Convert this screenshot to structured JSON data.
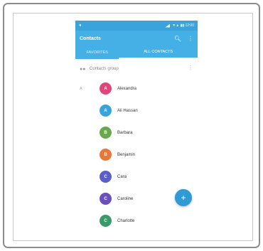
{
  "status": {
    "left": "●",
    "right": "▼▲ ▮▮ 12:00"
  },
  "appbar": {
    "title": "Contacts",
    "search_icon": "search-icon",
    "more_icon": "more-vert-icon"
  },
  "tabs": [
    {
      "label": "Favorites"
    },
    {
      "label": "All contacts"
    }
  ],
  "group": {
    "icon": "group-icon",
    "label": "Contacts group"
  },
  "contacts": [
    {
      "letter": "A",
      "initial": "A",
      "name": "Alexandra",
      "color": "#e0457a"
    },
    {
      "letter": "",
      "initial": "A",
      "name": "Ali Hassan",
      "color": "#3aa3db"
    },
    {
      "letter": "",
      "initial": "B",
      "name": "Barbara",
      "color": "#6aa84f"
    },
    {
      "letter": "",
      "initial": "B",
      "name": "Benjamin",
      "color": "#e8783a"
    },
    {
      "letter": "",
      "initial": "C",
      "name": "Cara",
      "color": "#5c5fc7"
    },
    {
      "letter": "",
      "initial": "C",
      "name": "Caroline",
      "color": "#6a4fbf"
    },
    {
      "letter": "",
      "initial": "C",
      "name": "Charlotte",
      "color": "#3a9a6a"
    }
  ],
  "fab": {
    "icon": "add-icon",
    "label": "+"
  }
}
